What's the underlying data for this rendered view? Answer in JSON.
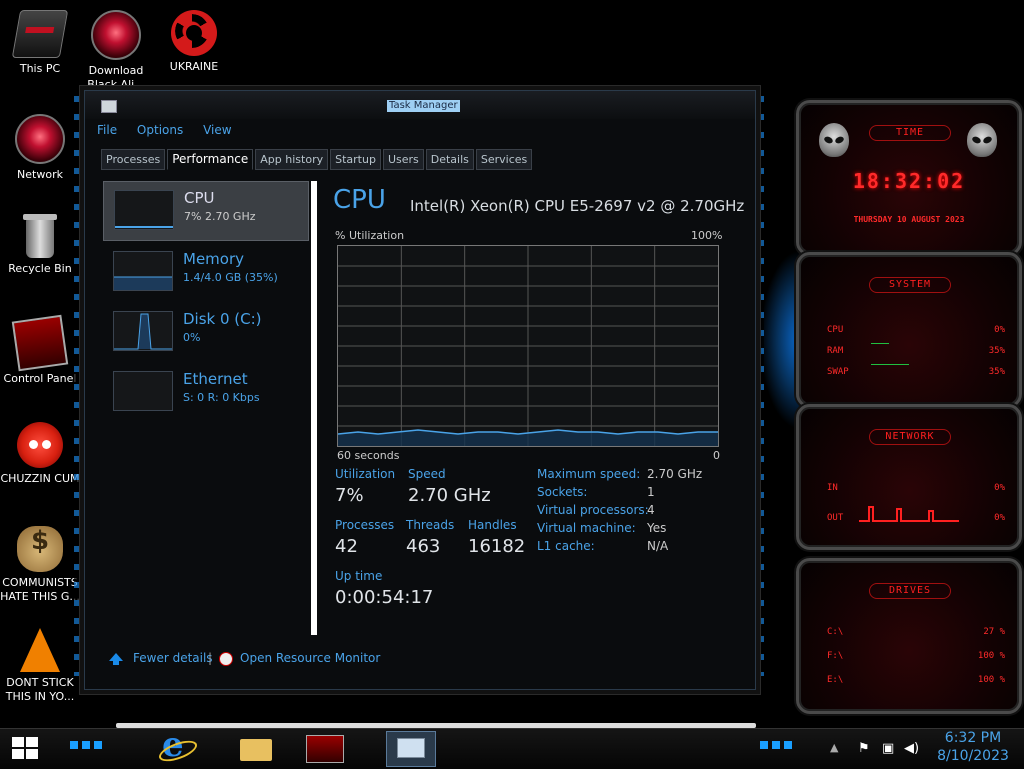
{
  "desktop": {
    "icons": [
      {
        "label": "This PC",
        "icon": "computer-icon"
      },
      {
        "label": "Download Black Ali...",
        "icon": "alien-orb-icon"
      },
      {
        "label": "UKRAINE",
        "icon": "radiation-icon"
      },
      {
        "label": "Network",
        "icon": "network-icon"
      },
      {
        "label": "Recycle Bin",
        "icon": "recycle-bin-icon"
      },
      {
        "label": "Control Panel",
        "icon": "control-panel-icon"
      },
      {
        "label": "CHUZZIN CUM",
        "icon": "chuzzle-icon"
      },
      {
        "label": "COMMUNISTS HATE THIS G...",
        "icon": "money-bag-icon"
      },
      {
        "label": "DONT STICK THIS IN YO...",
        "icon": "vlc-cone-icon"
      }
    ]
  },
  "taskmanager": {
    "title": "Task Manager",
    "menu": [
      "File",
      "Options",
      "View"
    ],
    "tabs": [
      "Processes",
      "Performance",
      "App history",
      "Startup",
      "Users",
      "Details",
      "Services"
    ],
    "active_tab": "Performance",
    "resources": [
      {
        "name": "CPU",
        "sub": "7% 2.70 GHz"
      },
      {
        "name": "Memory",
        "sub": "1.4/4.0 GB (35%)"
      },
      {
        "name": "Disk 0 (C:)",
        "sub": "0%"
      },
      {
        "name": "Ethernet",
        "sub": "S: 0 R: 0 Kbps"
      }
    ],
    "cpu": {
      "title": "CPU",
      "model": "Intel(R) Xeon(R) CPU E5-2697 v2 @ 2.70GHz",
      "util_label": "% Utilization",
      "util_max": "100%",
      "time_label": "60 seconds",
      "time_end": "0",
      "stats": {
        "utilization_label": "Utilization",
        "utilization": "7%",
        "speed_label": "Speed",
        "speed": "2.70 GHz",
        "processes_label": "Processes",
        "processes": "42",
        "threads_label": "Threads",
        "threads": "463",
        "handles_label": "Handles",
        "handles": "16182",
        "uptime_label": "Up time",
        "uptime": "0:00:54:17"
      },
      "specs": [
        {
          "k": "Maximum speed:",
          "v": "2.70 GHz"
        },
        {
          "k": "Sockets:",
          "v": "1"
        },
        {
          "k": "Virtual processors:",
          "v": "4"
        },
        {
          "k": "Virtual machine:",
          "v": "Yes"
        },
        {
          "k": "L1 cache:",
          "v": "N/A"
        }
      ],
      "history": [
        6,
        7,
        6,
        7,
        8,
        7,
        6,
        7,
        7,
        6,
        7,
        8,
        7,
        7,
        6,
        7,
        7,
        6,
        7,
        7
      ],
      "accent": "#4aa3e8"
    },
    "footer": {
      "fewer": "Fewer details",
      "sep": "|",
      "monitor": "Open Resource Monitor"
    }
  },
  "widgets": {
    "time": {
      "title": "TIME",
      "clock": "18:32:02",
      "date": "THURSDAY 10 AUGUST 2023"
    },
    "system": {
      "title": "SYSTEM",
      "rows": [
        {
          "k": "CPU",
          "v": "0%"
        },
        {
          "k": "RAM",
          "v": "35%"
        },
        {
          "k": "SWAP",
          "v": "35%"
        }
      ]
    },
    "network": {
      "title": "NETWORK",
      "rows": [
        {
          "k": "IN",
          "v": "0%"
        },
        {
          "k": "OUT",
          "v": "0%"
        }
      ]
    },
    "drives": {
      "title": "DRIVES",
      "rows": [
        {
          "k": "C:\\",
          "v": "27 %"
        },
        {
          "k": "F:\\",
          "v": "100 %"
        },
        {
          "k": "E:\\",
          "v": "100 %"
        }
      ]
    },
    "accent": "#ff2a2a"
  },
  "taskbar": {
    "time": "6:32 PM",
    "date": "8/10/2023",
    "apps": [
      "internet-explorer-icon",
      "file-explorer-icon",
      "control-panel-icon",
      "task-manager-icon"
    ],
    "tray": [
      "up-arrow-icon",
      "flag-icon",
      "network-icon",
      "volume-icon"
    ]
  }
}
